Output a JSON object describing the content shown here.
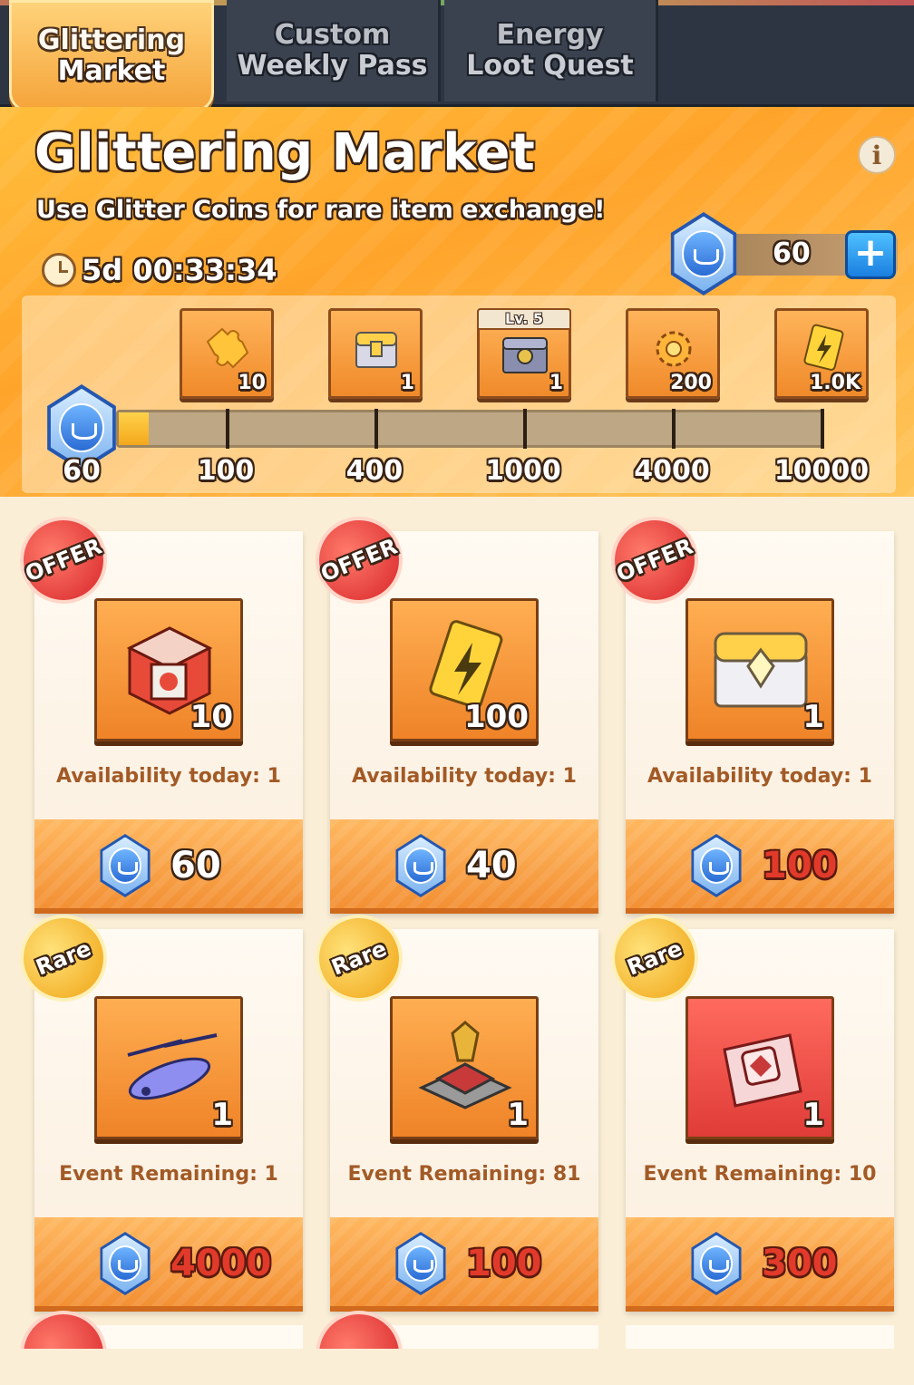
{
  "tabs": [
    {
      "line1": "Glittering",
      "line2": "Market",
      "active": true
    },
    {
      "line1": "Custom",
      "line2": "Weekly Pass",
      "active": false
    },
    {
      "line1": "Energy",
      "line2": "Loot Quest",
      "active": false
    }
  ],
  "header": {
    "title": "Glittering Market",
    "subtitle": "Use Glitter Coins for rare item exchange!",
    "timer": "5d 00:33:34",
    "coin_balance": "60",
    "info_label": "i",
    "plus_label": "+"
  },
  "progress": {
    "current_label": "60",
    "current_value": 60,
    "milestones": [
      {
        "label": "100",
        "qty": "10",
        "icon": "puzzle-piece-icon"
      },
      {
        "label": "400",
        "qty": "1",
        "icon": "treasure-chest-icon"
      },
      {
        "label": "1000",
        "qty": "1",
        "icon": "level-chest-icon",
        "level": "Lv. 5"
      },
      {
        "label": "4000",
        "qty": "200",
        "icon": "gear-parts-icon"
      },
      {
        "label": "10000",
        "qty": "1.0K",
        "icon": "energy-card-icon"
      }
    ]
  },
  "cards": [
    {
      "badge": "OFFER",
      "qty": "10",
      "status": "Availability today: 1",
      "price": "60",
      "price_affordable": true,
      "icon": "supply-cube-icon"
    },
    {
      "badge": "OFFER",
      "qty": "100",
      "status": "Availability today: 1",
      "price": "40",
      "price_affordable": true,
      "icon": "energy-card-icon"
    },
    {
      "badge": "OFFER",
      "qty": "1",
      "status": "Availability today: 1",
      "price": "100",
      "price_affordable": false,
      "icon": "gold-chest-icon"
    },
    {
      "badge": "Rare",
      "qty": "1",
      "status": "Event Remaining: 1",
      "price": "4000",
      "price_affordable": false,
      "icon": "helicopter-icon"
    },
    {
      "badge": "Rare",
      "qty": "1",
      "status": "Event Remaining: 81",
      "price": "100",
      "price_affordable": false,
      "icon": "trophy-base-icon"
    },
    {
      "badge": "Rare",
      "qty": "1",
      "status": "Event Remaining: 10",
      "price": "300",
      "price_affordable": false,
      "icon": "skin-card-icon"
    }
  ],
  "colors": {
    "accent_orange": "#f5a43a",
    "price_red": "#e23a2a",
    "coin_blue": "#2457b0",
    "tab_dark": "#2e3542"
  }
}
